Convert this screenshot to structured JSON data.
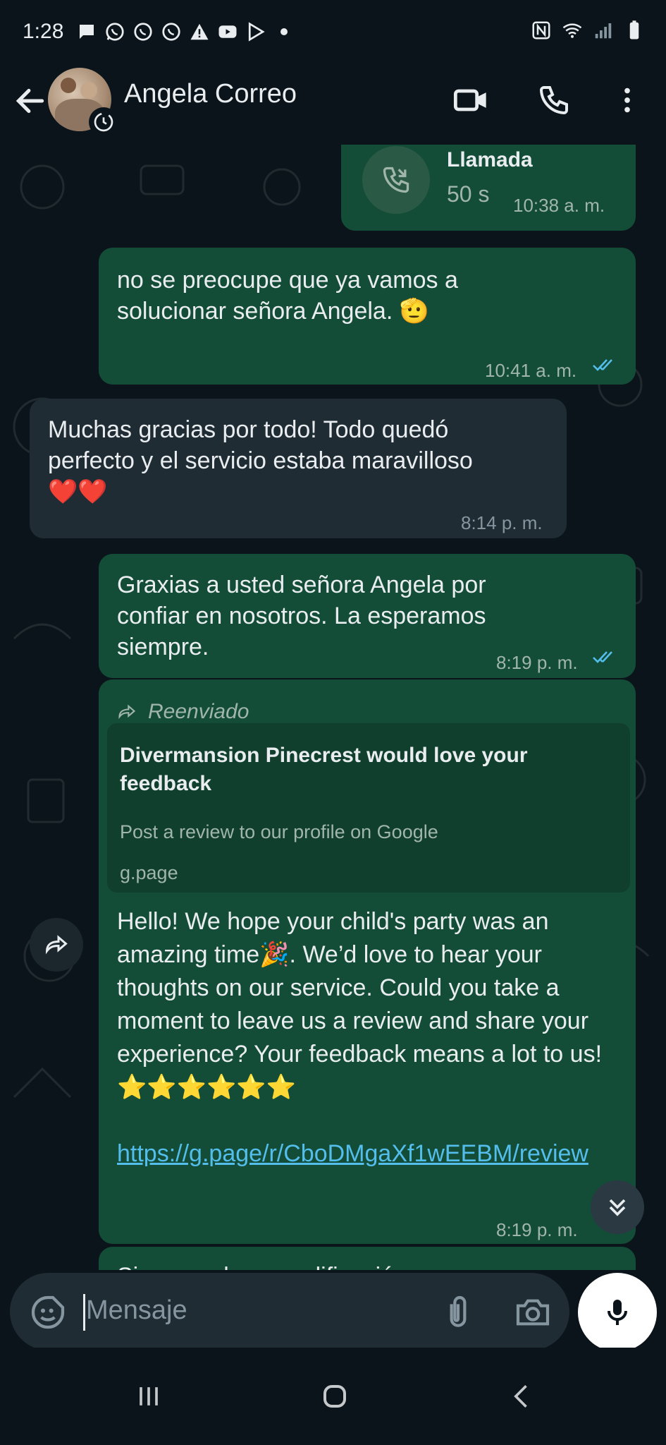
{
  "status_bar": {
    "time": "1:28"
  },
  "header": {
    "contact_name": "Angela Correo"
  },
  "messages": {
    "call": {
      "title": "Llamada",
      "duration": "50 s",
      "time": "10:38 a. m."
    },
    "m1": {
      "line1": "no se preocupe que ya vamos a",
      "line2": "solucionar señora Angela.",
      "emoji": "🫡",
      "time": "10:41 a. m."
    },
    "m2": {
      "line1": "Muchas gracias por todo! Todo quedó",
      "line2": "perfecto y el servicio estaba maravilloso",
      "emoji": "❤️❤️",
      "time": "8:14 p. m."
    },
    "m3": {
      "line1": "Graxias a usted señora Angela por",
      "line2": "confiar en nosotros. La esperamos",
      "line3": "siempre.",
      "time": "8:19 p. m."
    },
    "m4": {
      "forwarded_label": "Reenviado",
      "preview_title": "Divermansion Pinecrest would love your feedback",
      "preview_desc": "Post a review to our profile on Google",
      "preview_domain": "g.page",
      "text_part1": "Hello! We hope your child's party was an amazing time",
      "party_emoji": "🎉",
      "text_part2": ". We’d love to hear your thoughts on our service. Could you take a moment to leave us a review and share your experience? Your feedback means a lot to us! ",
      "stars": "⭐⭐⭐⭐⭐⭐",
      "link": "https://g.page/r/CboDMgaXf1wEEBM/review",
      "time": "8:19 p. m."
    },
    "m5_partial": "Si sus pedazo modificación"
  },
  "composer": {
    "placeholder": "Mensaje"
  }
}
